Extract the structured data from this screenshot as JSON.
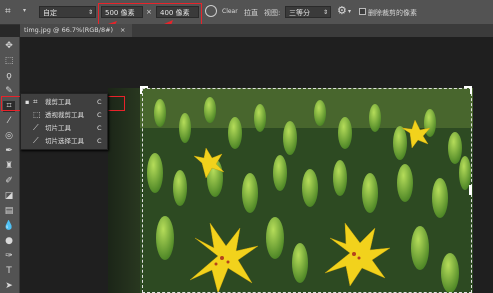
{
  "options_bar": {
    "tool_icon": "crop-icon",
    "preset_value": "自定",
    "width_value": "500 像素",
    "swap_symbol": "×",
    "height_value": "400 像素",
    "rotate_icon": "rotate-icon",
    "straighten_label": "拉直",
    "view_label": "视图:",
    "view_value": "三等分",
    "settings_icon": "gear-icon",
    "delete_cropped_label": "删除裁剪的像素",
    "delete_cropped_checked": false
  },
  "tab": {
    "title": "timg.jpg @ 66.7%(RGB/8#)",
    "close_symbol": "×"
  },
  "flyout": {
    "items": [
      {
        "label": "裁剪工具",
        "shortcut": "C",
        "icon": "crop-icon",
        "active": true
      },
      {
        "label": "透视裁剪工具",
        "shortcut": "C",
        "icon": "perspective-crop-icon",
        "active": false
      },
      {
        "label": "切片工具",
        "shortcut": "C",
        "icon": "slice-icon",
        "active": false
      },
      {
        "label": "切片选择工具",
        "shortcut": "C",
        "icon": "slice-select-icon",
        "active": false
      }
    ]
  },
  "toolbar": {
    "tools": [
      "move-icon",
      "marquee-icon",
      "lasso-icon",
      "quick-select-icon",
      "crop-icon",
      "eyedropper-icon",
      "healing-icon",
      "brush-icon",
      "stamp-icon",
      "history-brush-icon",
      "eraser-icon",
      "gradient-icon",
      "blur-icon",
      "dodge-icon",
      "pen-icon",
      "type-icon"
    ]
  },
  "colors": {
    "annotation_red": "#e8232a",
    "panel_gray": "#535353",
    "canvas_dark": "#1f1f1f",
    "flower_yellow": "#f2d21c",
    "leaf_green": "#4f8a2a"
  }
}
